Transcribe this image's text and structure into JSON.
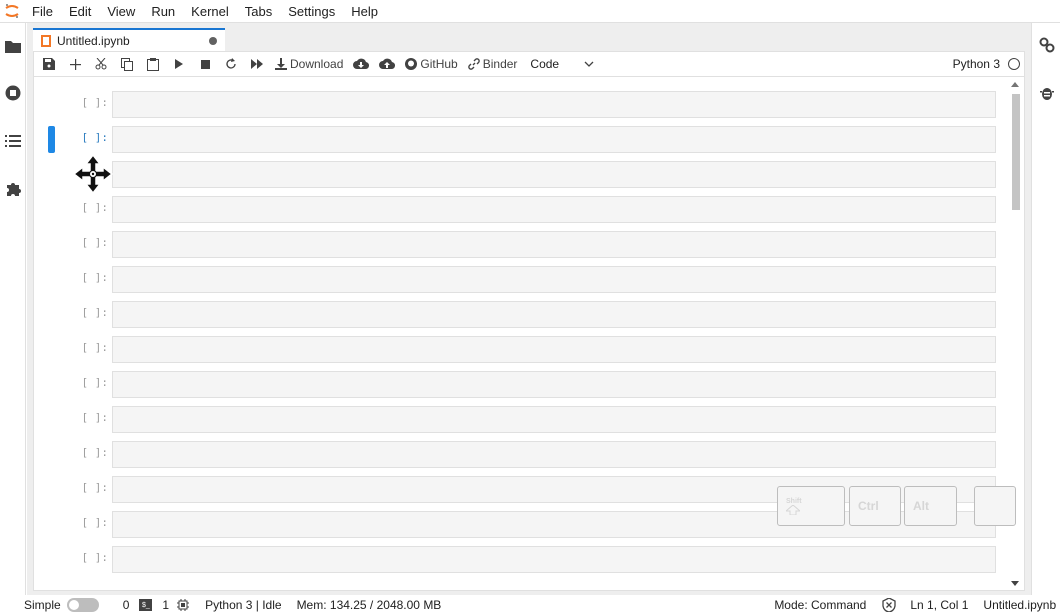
{
  "menu": [
    "File",
    "Edit",
    "View",
    "Run",
    "Kernel",
    "Tabs",
    "Settings",
    "Help"
  ],
  "tab": {
    "label": "Untitled.ipynb"
  },
  "toolbar": {
    "download_label": "Download",
    "github_label": "GitHub",
    "binder_label": "Binder",
    "cell_type": "Code",
    "kernel": "Python 3"
  },
  "cells": [
    {
      "prompt": "[ ]:"
    },
    {
      "prompt": "[ ]:"
    },
    {
      "prompt": ""
    },
    {
      "prompt": "[ ]:"
    },
    {
      "prompt": "[ ]:"
    },
    {
      "prompt": "[ ]:"
    },
    {
      "prompt": "[ ]:"
    },
    {
      "prompt": "[ ]:"
    },
    {
      "prompt": "[ ]:"
    },
    {
      "prompt": "[ ]:"
    },
    {
      "prompt": "[ ]:"
    },
    {
      "prompt": "[ ]:"
    },
    {
      "prompt": "[ ]:"
    },
    {
      "prompt": "[ ]:"
    }
  ],
  "keys": {
    "shift": "Shift",
    "ctrl": "Ctrl",
    "alt": "Alt"
  },
  "status": {
    "simple": "Simple",
    "count0": "0",
    "count1": "1",
    "kernel_status": "Python 3 | Idle",
    "mem": "Mem: 134.25 / 2048.00 MB",
    "mode": "Mode: Command",
    "position": "Ln 1, Col 1",
    "file": "Untitled.ipynb"
  },
  "colors": {
    "accent": "#1976d2",
    "active_cell": "#1e88e5",
    "logo": "#f37726"
  }
}
